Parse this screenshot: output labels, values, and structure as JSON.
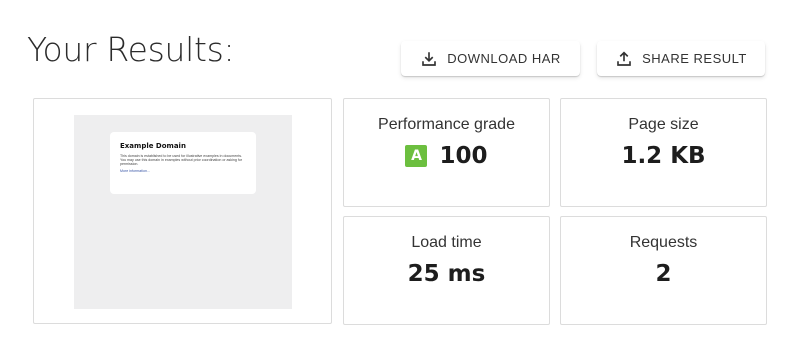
{
  "page": {
    "title": "Your Results:"
  },
  "actions": {
    "download": {
      "label": "DOWNLOAD HAR",
      "icon": "download-icon"
    },
    "share": {
      "label": "SHARE RESULT",
      "icon": "share-upload-icon"
    }
  },
  "preview": {
    "heading": "Example Domain",
    "body": "This domain is established to be used for illustrative examples in documents. You may use this domain in examples without prior coordination or asking for permission.",
    "link": "More information..."
  },
  "metrics": {
    "grade": {
      "label": "Performance grade",
      "letter": "A",
      "value": "100",
      "badge_color": "#6cbf3f"
    },
    "size": {
      "label": "Page size",
      "value": "1.2 KB"
    },
    "load": {
      "label": "Load time",
      "value": "25 ms"
    },
    "requests": {
      "label": "Requests",
      "value": "2"
    }
  }
}
